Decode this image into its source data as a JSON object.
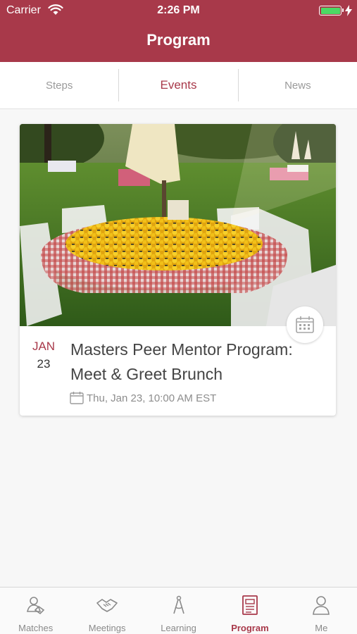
{
  "status_bar": {
    "carrier": "Carrier",
    "time": "2:26 PM"
  },
  "header": {
    "title": "Program"
  },
  "tabs": [
    {
      "label": "Steps",
      "active": false
    },
    {
      "label": "Events",
      "active": true
    },
    {
      "label": "News",
      "active": false
    }
  ],
  "event": {
    "month": "JAN",
    "day": "23",
    "title": "Masters Peer Mentor Program: Meet & Greet Brunch",
    "datetime": "Thu, Jan 23, 10:00 AM EST"
  },
  "tabbar": [
    {
      "label": "Matches",
      "icon": "matches-icon",
      "active": false
    },
    {
      "label": "Meetings",
      "icon": "handshake-icon",
      "active": false
    },
    {
      "label": "Learning",
      "icon": "compass-icon",
      "active": false
    },
    {
      "label": "Program",
      "icon": "document-icon",
      "active": true
    },
    {
      "label": "Me",
      "icon": "person-icon",
      "active": false
    }
  ],
  "colors": {
    "brand": "#a8394a",
    "battery": "#4cd964",
    "inactive": "#8a8a8a"
  }
}
